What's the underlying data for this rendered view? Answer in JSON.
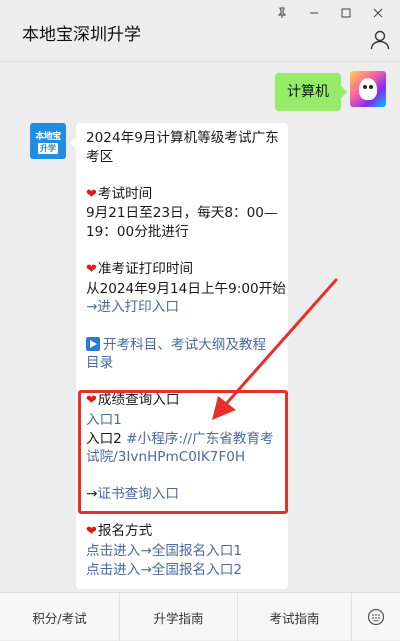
{
  "chat": {
    "title": "本地宝深圳升学"
  },
  "outgoing": {
    "text": "计算机"
  },
  "bot_avatar": {
    "line1": "本地宝",
    "line2": "升学"
  },
  "message": {
    "title_line1": "2024年9月计算机等级考试广东",
    "title_line2": "考区",
    "exam_time": {
      "heading": "考试时间",
      "line1": "9月21日至23日，每天8：00—",
      "line2": "19：00分批进行"
    },
    "admission_print": {
      "heading": "准考证打印时间",
      "line1": "从2024年9月14日上午9:00开始",
      "link": "→进入打印入口"
    },
    "subjects": {
      "line1": "开考科目、考试大纲及教程",
      "line2": "目录"
    },
    "score_query": {
      "heading": "成绩查询入口",
      "entry1": "入口1",
      "entry2_label": "入口2 ",
      "entry2_link_line1": "#小程序://广东省教育考",
      "entry2_link_line2": "试院/3IvnHPmC0IK7F0H",
      "certificate_link": "→证书查询入口"
    },
    "registration": {
      "heading": "报名方式",
      "link1": "点击进入→全国报名入口1",
      "link2": "点击进入→全国报名入口2"
    }
  },
  "menu": {
    "item1": "积分/考试",
    "item2": "升学指南",
    "item3": "考试指南"
  },
  "colors": {
    "annotation": "#e8302a",
    "outgoing_bubble": "#95ec69",
    "link": "#4a6ba0"
  }
}
